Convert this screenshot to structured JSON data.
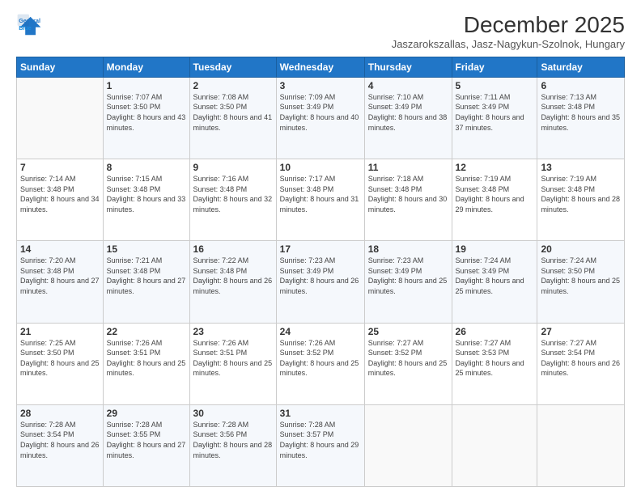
{
  "header": {
    "logo_line1": "General",
    "logo_line2": "Blue",
    "main_title": "December 2025",
    "subtitle": "Jaszarokszallas, Jasz-Nagykun-Szolnok, Hungary"
  },
  "days_of_week": [
    "Sunday",
    "Monday",
    "Tuesday",
    "Wednesday",
    "Thursday",
    "Friday",
    "Saturday"
  ],
  "weeks": [
    [
      {
        "day": "",
        "sunrise": "",
        "sunset": "",
        "daylight": ""
      },
      {
        "day": "1",
        "sunrise": "Sunrise: 7:07 AM",
        "sunset": "Sunset: 3:50 PM",
        "daylight": "Daylight: 8 hours and 43 minutes."
      },
      {
        "day": "2",
        "sunrise": "Sunrise: 7:08 AM",
        "sunset": "Sunset: 3:50 PM",
        "daylight": "Daylight: 8 hours and 41 minutes."
      },
      {
        "day": "3",
        "sunrise": "Sunrise: 7:09 AM",
        "sunset": "Sunset: 3:49 PM",
        "daylight": "Daylight: 8 hours and 40 minutes."
      },
      {
        "day": "4",
        "sunrise": "Sunrise: 7:10 AM",
        "sunset": "Sunset: 3:49 PM",
        "daylight": "Daylight: 8 hours and 38 minutes."
      },
      {
        "day": "5",
        "sunrise": "Sunrise: 7:11 AM",
        "sunset": "Sunset: 3:49 PM",
        "daylight": "Daylight: 8 hours and 37 minutes."
      },
      {
        "day": "6",
        "sunrise": "Sunrise: 7:13 AM",
        "sunset": "Sunset: 3:48 PM",
        "daylight": "Daylight: 8 hours and 35 minutes."
      }
    ],
    [
      {
        "day": "7",
        "sunrise": "Sunrise: 7:14 AM",
        "sunset": "Sunset: 3:48 PM",
        "daylight": "Daylight: 8 hours and 34 minutes."
      },
      {
        "day": "8",
        "sunrise": "Sunrise: 7:15 AM",
        "sunset": "Sunset: 3:48 PM",
        "daylight": "Daylight: 8 hours and 33 minutes."
      },
      {
        "day": "9",
        "sunrise": "Sunrise: 7:16 AM",
        "sunset": "Sunset: 3:48 PM",
        "daylight": "Daylight: 8 hours and 32 minutes."
      },
      {
        "day": "10",
        "sunrise": "Sunrise: 7:17 AM",
        "sunset": "Sunset: 3:48 PM",
        "daylight": "Daylight: 8 hours and 31 minutes."
      },
      {
        "day": "11",
        "sunrise": "Sunrise: 7:18 AM",
        "sunset": "Sunset: 3:48 PM",
        "daylight": "Daylight: 8 hours and 30 minutes."
      },
      {
        "day": "12",
        "sunrise": "Sunrise: 7:19 AM",
        "sunset": "Sunset: 3:48 PM",
        "daylight": "Daylight: 8 hours and 29 minutes."
      },
      {
        "day": "13",
        "sunrise": "Sunrise: 7:19 AM",
        "sunset": "Sunset: 3:48 PM",
        "daylight": "Daylight: 8 hours and 28 minutes."
      }
    ],
    [
      {
        "day": "14",
        "sunrise": "Sunrise: 7:20 AM",
        "sunset": "Sunset: 3:48 PM",
        "daylight": "Daylight: 8 hours and 27 minutes."
      },
      {
        "day": "15",
        "sunrise": "Sunrise: 7:21 AM",
        "sunset": "Sunset: 3:48 PM",
        "daylight": "Daylight: 8 hours and 27 minutes."
      },
      {
        "day": "16",
        "sunrise": "Sunrise: 7:22 AM",
        "sunset": "Sunset: 3:48 PM",
        "daylight": "Daylight: 8 hours and 26 minutes."
      },
      {
        "day": "17",
        "sunrise": "Sunrise: 7:23 AM",
        "sunset": "Sunset: 3:49 PM",
        "daylight": "Daylight: 8 hours and 26 minutes."
      },
      {
        "day": "18",
        "sunrise": "Sunrise: 7:23 AM",
        "sunset": "Sunset: 3:49 PM",
        "daylight": "Daylight: 8 hours and 25 minutes."
      },
      {
        "day": "19",
        "sunrise": "Sunrise: 7:24 AM",
        "sunset": "Sunset: 3:49 PM",
        "daylight": "Daylight: 8 hours and 25 minutes."
      },
      {
        "day": "20",
        "sunrise": "Sunrise: 7:24 AM",
        "sunset": "Sunset: 3:50 PM",
        "daylight": "Daylight: 8 hours and 25 minutes."
      }
    ],
    [
      {
        "day": "21",
        "sunrise": "Sunrise: 7:25 AM",
        "sunset": "Sunset: 3:50 PM",
        "daylight": "Daylight: 8 hours and 25 minutes."
      },
      {
        "day": "22",
        "sunrise": "Sunrise: 7:26 AM",
        "sunset": "Sunset: 3:51 PM",
        "daylight": "Daylight: 8 hours and 25 minutes."
      },
      {
        "day": "23",
        "sunrise": "Sunrise: 7:26 AM",
        "sunset": "Sunset: 3:51 PM",
        "daylight": "Daylight: 8 hours and 25 minutes."
      },
      {
        "day": "24",
        "sunrise": "Sunrise: 7:26 AM",
        "sunset": "Sunset: 3:52 PM",
        "daylight": "Daylight: 8 hours and 25 minutes."
      },
      {
        "day": "25",
        "sunrise": "Sunrise: 7:27 AM",
        "sunset": "Sunset: 3:52 PM",
        "daylight": "Daylight: 8 hours and 25 minutes."
      },
      {
        "day": "26",
        "sunrise": "Sunrise: 7:27 AM",
        "sunset": "Sunset: 3:53 PM",
        "daylight": "Daylight: 8 hours and 25 minutes."
      },
      {
        "day": "27",
        "sunrise": "Sunrise: 7:27 AM",
        "sunset": "Sunset: 3:54 PM",
        "daylight": "Daylight: 8 hours and 26 minutes."
      }
    ],
    [
      {
        "day": "28",
        "sunrise": "Sunrise: 7:28 AM",
        "sunset": "Sunset: 3:54 PM",
        "daylight": "Daylight: 8 hours and 26 minutes."
      },
      {
        "day": "29",
        "sunrise": "Sunrise: 7:28 AM",
        "sunset": "Sunset: 3:55 PM",
        "daylight": "Daylight: 8 hours and 27 minutes."
      },
      {
        "day": "30",
        "sunrise": "Sunrise: 7:28 AM",
        "sunset": "Sunset: 3:56 PM",
        "daylight": "Daylight: 8 hours and 28 minutes."
      },
      {
        "day": "31",
        "sunrise": "Sunrise: 7:28 AM",
        "sunset": "Sunset: 3:57 PM",
        "daylight": "Daylight: 8 hours and 29 minutes."
      },
      {
        "day": "",
        "sunrise": "",
        "sunset": "",
        "daylight": ""
      },
      {
        "day": "",
        "sunrise": "",
        "sunset": "",
        "daylight": ""
      },
      {
        "day": "",
        "sunrise": "",
        "sunset": "",
        "daylight": ""
      }
    ]
  ]
}
